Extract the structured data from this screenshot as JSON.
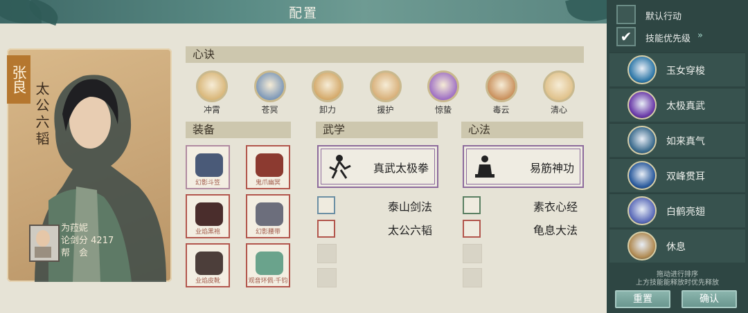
{
  "title": "配置",
  "character": {
    "name": "张良",
    "book": "太公六韬",
    "player_name": "为菈妮",
    "rank_label": "论剑分",
    "rank_value": "4217",
    "guild_label": "帮　会"
  },
  "sections": {
    "xinjue": "心诀",
    "equip": "装备",
    "wuxue": "武学",
    "xinfa": "心法"
  },
  "xinjue_skills": [
    {
      "label": "冲霄",
      "color": "#d9b77a"
    },
    {
      "label": "苍冥",
      "color": "#7d98b8"
    },
    {
      "label": "卸力",
      "color": "#d4a96a"
    },
    {
      "label": "援护",
      "color": "#d8b07a"
    },
    {
      "label": "惊蛰",
      "color": "#9e6fc4"
    },
    {
      "label": "毒云",
      "color": "#c9905c"
    },
    {
      "label": "清心",
      "color": "#e0c28c"
    }
  ],
  "equipment": [
    {
      "label": "幻影斗笠",
      "color": "#4a5a78"
    },
    {
      "label": "鬼爪幽冥",
      "color": "#8c3a30"
    },
    {
      "label": "业焰黑袍",
      "color": "#4a2d2c"
    },
    {
      "label": "幻影腰带",
      "color": "#6c6e7c"
    },
    {
      "label": "业焰皮靴",
      "color": "#4c3e3a"
    },
    {
      "label": "观音环佩·千钧",
      "color": "#6aa38c"
    }
  ],
  "wuxue": {
    "main": "真武太极拳",
    "subs": [
      "泰山剑法",
      "太公六韬"
    ]
  },
  "xinfa": {
    "main": "易筋神功",
    "subs": [
      "素衣心经",
      "龟息大法"
    ]
  },
  "panel": {
    "default_action": "默认行动",
    "skill_priority": "技能优先级",
    "skill_priority_checked": true,
    "skills": [
      {
        "name": "玉女穿梭",
        "color": "#2f78a8"
      },
      {
        "name": "太极真武",
        "color": "#6a3aa8"
      },
      {
        "name": "如来真气",
        "color": "#3a6a8c"
      },
      {
        "name": "双峰贯耳",
        "color": "#2a5a9c"
      },
      {
        "name": "白鹤亮翅",
        "color": "#5a6ab8"
      },
      {
        "name": "休息",
        "color": "#b08a52"
      }
    ],
    "hint_line1": "拖动进行排序",
    "hint_line2": "上方技能能释放时优先释放",
    "reset": "重置",
    "confirm": "确认"
  }
}
